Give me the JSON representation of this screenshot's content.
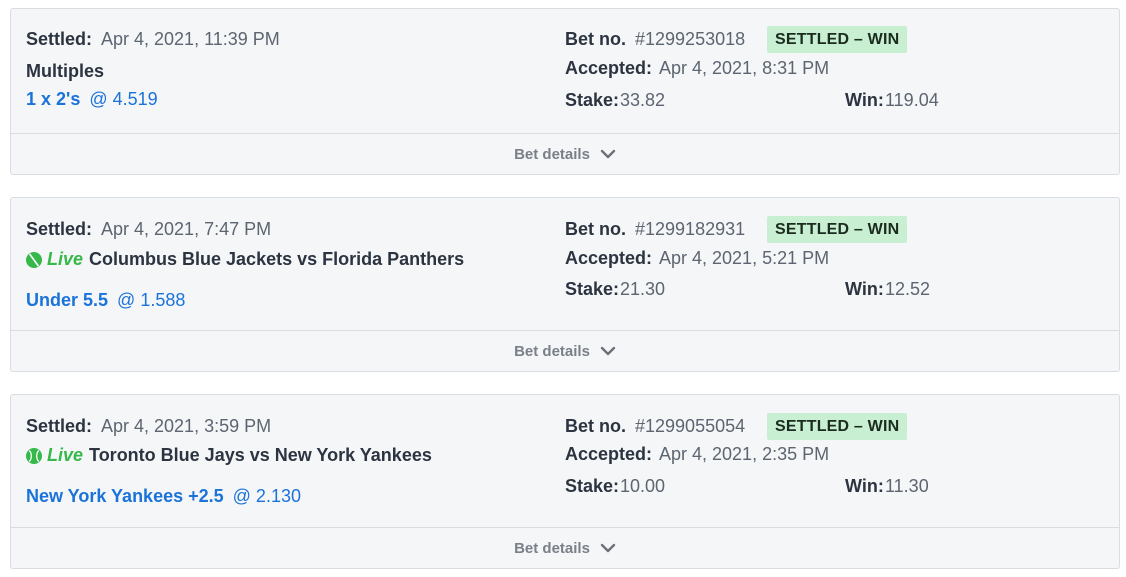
{
  "labels": {
    "settled": "Settled:",
    "bet_no": "Bet no.",
    "accepted": "Accepted:",
    "stake": "Stake:",
    "win": "Win:",
    "bet_details": "Bet details"
  },
  "colors": {
    "live": "#36b84a",
    "selection": "#1a73d9",
    "badge_bg": "#c8efd1"
  },
  "bets": [
    {
      "settled": "Apr 4, 2021, 11:39 PM",
      "event_label": "Multiples",
      "is_live": false,
      "selection": "1 x 2's",
      "odds": "@ 4.519",
      "bet_no": "#1299253018",
      "status": "SETTLED  –  WIN",
      "accepted": "Apr 4, 2021, 8:31 PM",
      "stake": "33.82",
      "win": "119.04"
    },
    {
      "settled": "Apr 4, 2021, 7:47 PM",
      "live_label": "Live",
      "sport_icon": "hockey-icon",
      "event_label": "Columbus Blue Jackets vs Florida Panthers",
      "is_live": true,
      "selection": "Under 5.5",
      "odds": "@ 1.588",
      "bet_no": "#1299182931",
      "status": "SETTLED  –  WIN",
      "accepted": "Apr 4, 2021, 5:21 PM",
      "stake": "21.30",
      "win": "12.52"
    },
    {
      "settled": "Apr 4, 2021, 3:59 PM",
      "live_label": "Live",
      "sport_icon": "baseball-icon",
      "event_label": "Toronto Blue Jays vs New York Yankees",
      "is_live": true,
      "selection": "New York Yankees +2.5",
      "odds": "@ 2.130",
      "bet_no": "#1299055054",
      "status": "SETTLED  –  WIN",
      "accepted": "Apr 4, 2021, 2:35 PM",
      "stake": "10.00",
      "win": "11.30"
    }
  ]
}
